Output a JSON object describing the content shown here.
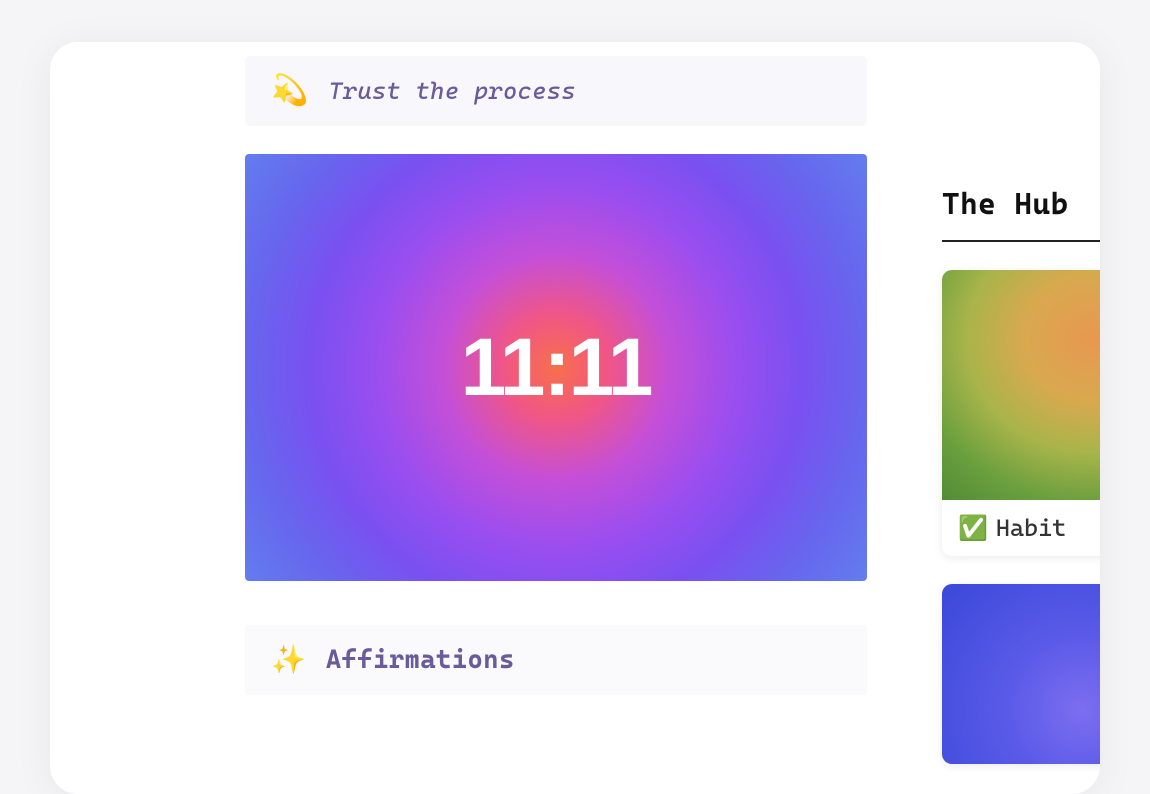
{
  "quote": {
    "icon": "💫",
    "text": "Trust the process"
  },
  "hero": {
    "text": "11:11"
  },
  "section": {
    "icon": "✨",
    "title": "Affirmations"
  },
  "hub": {
    "title": "The Hub",
    "cards": [
      {
        "emoji": "✅",
        "label": "Habit"
      }
    ]
  }
}
